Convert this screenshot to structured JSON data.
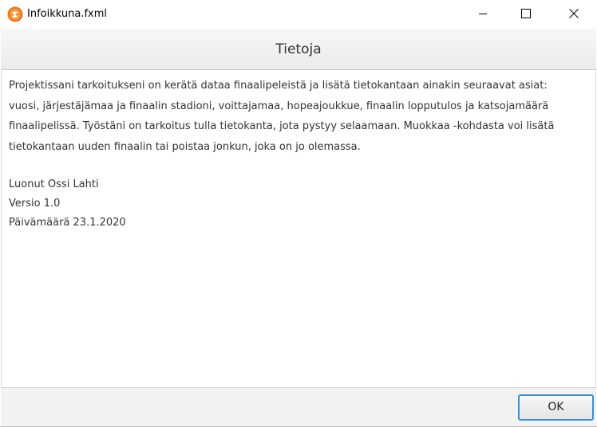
{
  "window": {
    "title": "Infoikkuna.fxml",
    "app_icon": "app-logo-icon",
    "controls": {
      "minimize_icon": "minimize-icon",
      "maximize_icon": "maximize-icon",
      "close_icon": "close-icon"
    }
  },
  "header": {
    "title": "Tietoja"
  },
  "content": {
    "paragraph_lines": [
      "Projektissani tarkoitukseni on kerätä dataa finaalipeleistä ja lisätä tietokantaan ainakin seuraavat asiat:",
      "vuosi, järjestäjämaa ja finaalin stadioni, voittajamaa, hopeajoukkue, finaalin lopputulos ja katsojamäärä",
      "finaalipelissä. Työstäni on tarkoitus tulla tietokanta, jota pystyy selaamaan. Muokkaa -kohdasta voi lisätä",
      "tietokantaan uuden finaalin tai poistaa jonkun, joka on jo olemassa."
    ],
    "author": "Luonut Ossi Lahti",
    "version": "Versio 1.0",
    "date": "Päivämäärä 23.1.2020"
  },
  "footer": {
    "ok_label": "OK"
  },
  "colors": {
    "accent_border": "#3e8fd4",
    "text": "#333333",
    "app_icon_orange": "#f0731e"
  }
}
